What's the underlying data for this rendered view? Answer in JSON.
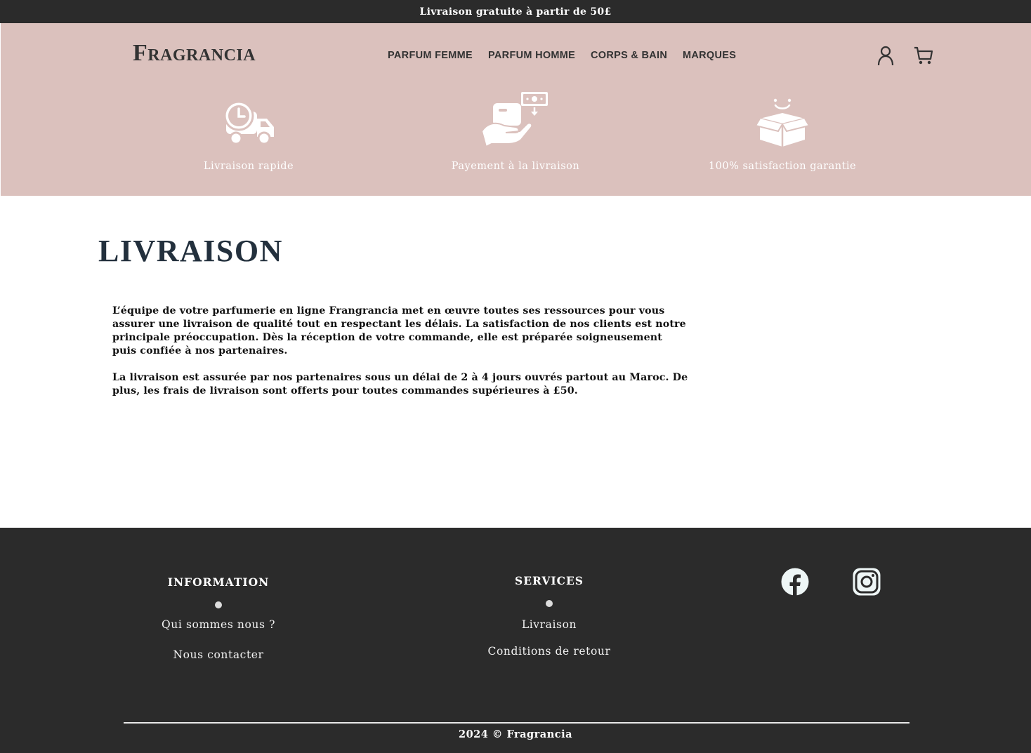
{
  "announcement": "Livraison gratuite à partir de 50£",
  "brand": {
    "logo_text": "Fragrancia"
  },
  "nav": {
    "items": [
      {
        "label": "PARFUM FEMME"
      },
      {
        "label": "PARFUM HOMME"
      },
      {
        "label": "CORPS & BAIN"
      },
      {
        "label": "MARQUES"
      }
    ]
  },
  "header_icons": [
    "user-icon",
    "cart-icon"
  ],
  "features": [
    {
      "icon": "delivery-truck-clock-icon",
      "label": "Livraison rapide"
    },
    {
      "icon": "cash-on-delivery-icon",
      "label": "Payement à la livraison"
    },
    {
      "icon": "happy-box-icon",
      "label": "100% satisfaction garantie"
    }
  ],
  "page": {
    "title": "LIVRAISON",
    "paragraphs": [
      "L’équipe de votre parfumerie en ligne Frangrancia met en œuvre toutes ses ressources pour vous assurer une livraison de qualité tout en respectant les délais. La satisfaction de nos clients est notre principale préoccupation. Dès la réception de votre commande, elle est préparée soigneusement puis confiée à nos partenaires.",
      "La livraison est assurée par nos partenaires sous un délai de 2 à 4 jours ouvrés partout au Maroc. De plus, les frais de livraison sont offerts pour toutes commandes supérieures à £50."
    ]
  },
  "footer": {
    "information": {
      "heading": "INFORMATION",
      "links": [
        "Qui sommes nous ?",
        "Nous contacter"
      ]
    },
    "services": {
      "heading": "SERVICES",
      "links": [
        "Livraison",
        "Conditions de retour"
      ]
    },
    "social": [
      "facebook-icon",
      "instagram-icon"
    ],
    "copyright": "2024 © Fragrancia"
  },
  "colors": {
    "topbar_bg": "#2b2b2b",
    "header_bg": "#dbc1bd",
    "title": "#23303d",
    "footer_bg": "#2b2b2b"
  }
}
